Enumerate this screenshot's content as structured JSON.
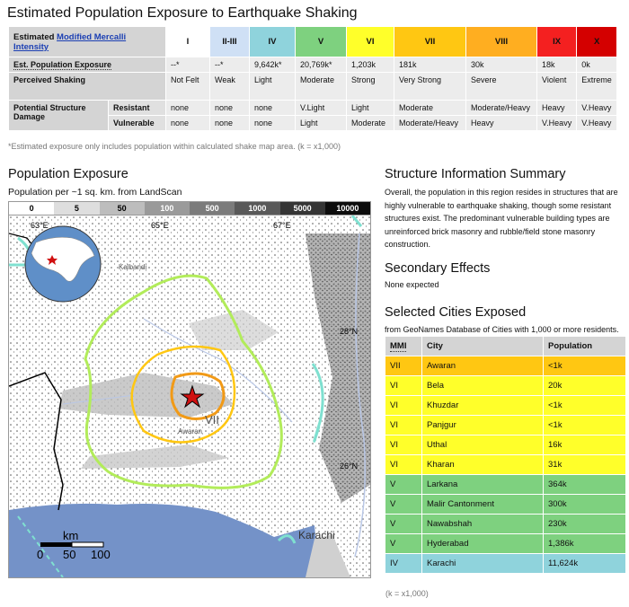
{
  "title": "Estimated Population Exposure to Earthquake Shaking",
  "mmi_table": {
    "corner_label_prefix": "Estimated",
    "corner_label_link": "Modified Mercalli Intensity",
    "columns": [
      {
        "label": "I",
        "color": "#ffffff"
      },
      {
        "label": "II-III",
        "color": "#cfe0f5"
      },
      {
        "label": "IV",
        "color": "#8fd3dc"
      },
      {
        "label": "V",
        "color": "#7ed17f"
      },
      {
        "label": "VI",
        "color": "#ffff2a"
      },
      {
        "label": "VII",
        "color": "#ffc712"
      },
      {
        "label": "VIII",
        "color": "#ffae20"
      },
      {
        "label": "IX",
        "color": "#f42020"
      },
      {
        "label": "X",
        "color": "#d40000"
      }
    ],
    "exposure_label": "Est. Population Exposure",
    "exposure": [
      "--*",
      "--*",
      "9,642k*",
      "20,769k*",
      "1,203k",
      "181k",
      "30k",
      "18k",
      "0k"
    ],
    "shaking_label": "Perceived Shaking",
    "shaking": [
      "Not Felt",
      "Weak",
      "Light",
      "Moderate",
      "Strong",
      "Very Strong",
      "Severe",
      "Violent",
      "Extreme"
    ],
    "damage_label": "Potential Structure Damage",
    "resistant_label": "Resistant",
    "resistant": [
      "none",
      "none",
      "none",
      "V.Light",
      "Light",
      "Moderate",
      "Moderate/Heavy",
      "Heavy",
      "V.Heavy"
    ],
    "vulnerable_label": "Vulnerable",
    "vulnerable": [
      "none",
      "none",
      "none",
      "Light",
      "Moderate",
      "Moderate/Heavy",
      "Heavy",
      "V.Heavy",
      "V.Heavy"
    ],
    "footnote": "*Estimated exposure only includes population within calculated shake map area. (k = x1,000)"
  },
  "population": {
    "heading": "Population Exposure",
    "subheading": "Population per ~1 sq. km. from LandScan",
    "legend": [
      {
        "label": "0",
        "bg": "#ffffff",
        "fg": "#000000"
      },
      {
        "label": "5",
        "bg": "#dedede",
        "fg": "#000000"
      },
      {
        "label": "50",
        "bg": "#bdbdbd",
        "fg": "#000000"
      },
      {
        "label": "100",
        "bg": "#9a9a9a",
        "fg": "#ffffff"
      },
      {
        "label": "500",
        "bg": "#7b7b7b",
        "fg": "#ffffff"
      },
      {
        "label": "1000",
        "bg": "#595959",
        "fg": "#ffffff"
      },
      {
        "label": "5000",
        "bg": "#353535",
        "fg": "#ffffff"
      },
      {
        "label": "10000",
        "bg": "#0d0d0d",
        "fg": "#ffffff"
      }
    ],
    "map": {
      "lon_labels": [
        "63°E",
        "65°E",
        "67°E"
      ],
      "lat_labels": [
        "28°N",
        "26°N"
      ],
      "intensity_label": "VII",
      "city_kalbandri": "Kalbandi",
      "city_awaran": "Awaran",
      "city_karachi": "Karachi",
      "scale_unit": "km",
      "scale_ticks": [
        "0",
        "50",
        "100"
      ],
      "ocean_color": "#7492c8"
    }
  },
  "structure": {
    "heading": "Structure Information Summary",
    "text": "Overall, the population in this region resides in structures that are highly vulnerable to earthquake shaking, though some resistant structures exist. The predominant vulnerable building types are unreinforced brick masonry and rubble/field stone masonry construction."
  },
  "secondary": {
    "heading": "Secondary Effects",
    "text": "None expected"
  },
  "cities": {
    "heading": "Selected Cities Exposed",
    "source": "from GeoNames Database of Cities with 1,000 or more residents.",
    "col_mmi": "MMI",
    "col_city": "City",
    "col_pop": "Population",
    "rows": [
      {
        "mmi": "VII",
        "city": "Awaran",
        "pop": "<1k",
        "color": "#ffc712"
      },
      {
        "mmi": "VI",
        "city": "Bela",
        "pop": "20k",
        "color": "#ffff2a"
      },
      {
        "mmi": "VI",
        "city": "Khuzdar",
        "pop": "<1k",
        "color": "#ffff2a"
      },
      {
        "mmi": "VI",
        "city": "Panjgur",
        "pop": "<1k",
        "color": "#ffff2a"
      },
      {
        "mmi": "VI",
        "city": "Uthal",
        "pop": "16k",
        "color": "#ffff2a"
      },
      {
        "mmi": "VI",
        "city": "Kharan",
        "pop": "31k",
        "color": "#ffff2a"
      },
      {
        "mmi": "V",
        "city": "Larkana",
        "pop": "364k",
        "color": "#7ed17f"
      },
      {
        "mmi": "V",
        "city": "Malir Cantonment",
        "pop": "300k",
        "color": "#7ed17f"
      },
      {
        "mmi": "V",
        "city": "Nawabshah",
        "pop": "230k",
        "color": "#7ed17f"
      },
      {
        "mmi": "V",
        "city": "Hyderabad",
        "pop": "1,386k",
        "color": "#7ed17f"
      },
      {
        "mmi": "IV",
        "city": "Karachi",
        "pop": "11,624k",
        "color": "#8fd3dc"
      }
    ],
    "footnote": "(k = x1,000)"
  }
}
